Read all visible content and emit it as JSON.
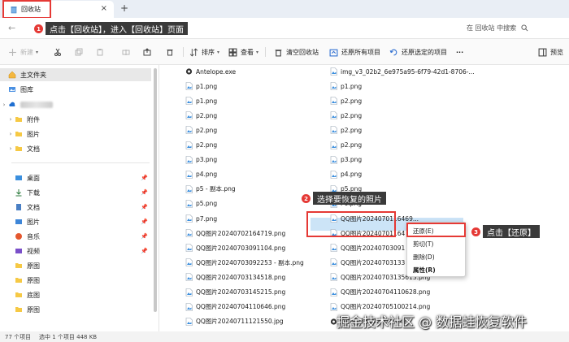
{
  "titlebar": {
    "tab_label": "回收站",
    "close": "×",
    "new_tab": "+"
  },
  "addressbar": {
    "back": "←",
    "search_placeholder": "在 回收站 中搜索"
  },
  "toolbar": {
    "new": "新建",
    "sort": "排序",
    "view": "查看",
    "empty": "清空回收站",
    "restore_all": "还原所有项目",
    "restore_selected": "还原选定的项目",
    "more": "···",
    "preview": "预览"
  },
  "sidebar": {
    "home": "主文件夹",
    "gallery": "图库",
    "cloud_folders": [
      "附件",
      "图片",
      "文档"
    ],
    "quick": [
      "桌面",
      "下载",
      "文档",
      "图片",
      "音乐",
      "视频",
      "原图",
      "原图",
      "底图",
      "原图"
    ]
  },
  "files_col1": [
    "Antelope.exe",
    "p1.png",
    "p1.png",
    "p2.png",
    "p2.png",
    "p2.png",
    "p3.png",
    "p4.png",
    "p5 - 副本.png",
    "p5.png",
    "p7.png",
    "QQ图片20240702164719.png",
    "QQ图片20240703091104.png",
    "QQ图片20240703092253 - 副本.png",
    "QQ图片20240703134518.png",
    "QQ图片20240703145215.png",
    "QQ图片20240704110646.png",
    "QQ图片20240711121550.jpg"
  ],
  "files_col2": [
    "img_v3_02b2_6e975a95-6f79-42d1-8706-...",
    "p1.png",
    "p2.png",
    "p2.png",
    "p2.png",
    "p2.png",
    "p3.png",
    "p4.png",
    "p5.png",
    "P6.png",
    "QQ图片2024070116469...",
    "QQ图片20240701164",
    "QQ图片20240703091",
    "QQ图片20240703133",
    "QQ图片20240703135613.png",
    "QQ图片20240704110628.png",
    "QQ图片20240705100214.png",
    "setup_13102002l.exe"
  ],
  "statusbar": {
    "count": "77 个项目",
    "selected": "选中 1 个项目  448 KB"
  },
  "context_menu": {
    "restore": "还原(E)",
    "cut": "剪切(T)",
    "delete": "删除(D)",
    "properties": "属性(R)"
  },
  "annotations": {
    "step1": "点击【回收站】，进入【回收站】页面",
    "step2": "选择要恢复的照片",
    "step3": "点击【还原】",
    "n1": "1",
    "n2": "2",
    "n3": "3"
  },
  "watermark": "掘金技术社区 @ 数据蛙恢复软件"
}
